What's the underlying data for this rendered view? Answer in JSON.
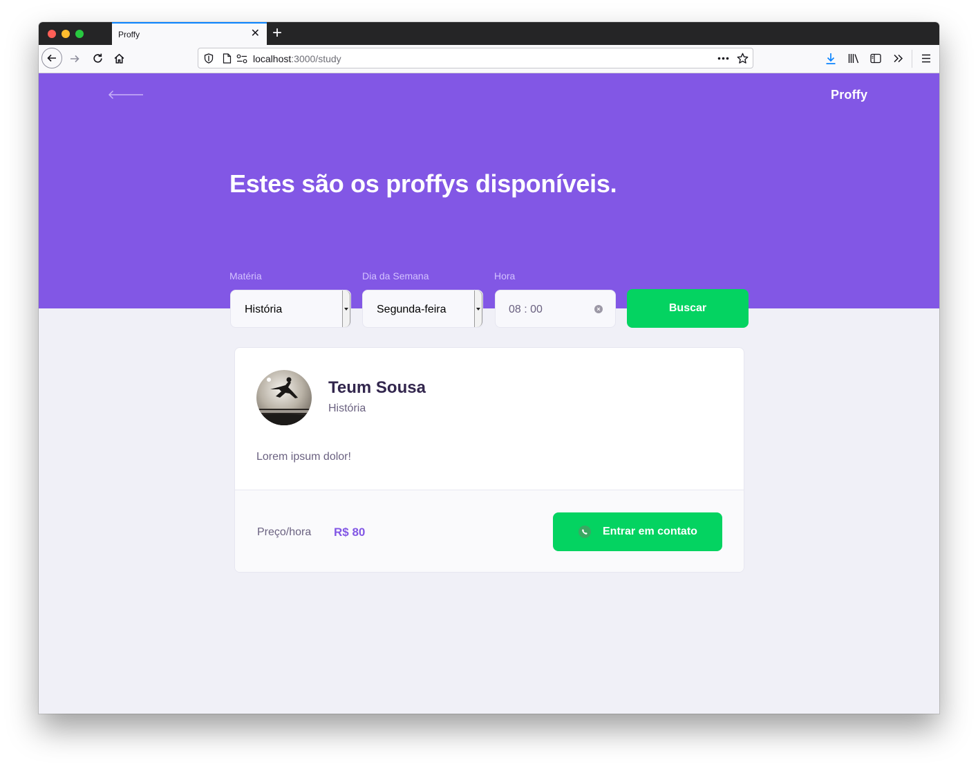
{
  "browser": {
    "tab_title": "Proffy",
    "tab_close": "✕",
    "new_tab": "+",
    "url_host": "localhost",
    "url_path": ":3000/study"
  },
  "header": {
    "brand": "Proffy",
    "title": "Estes são os proffys disponíveis."
  },
  "filters": {
    "subject_label": "Matéria",
    "subject_value": "História",
    "weekday_label": "Dia da Semana",
    "weekday_value": "Segunda-feira",
    "time_label": "Hora",
    "time_value": "08 : 00",
    "submit_label": "Buscar"
  },
  "teacher": {
    "name": "Teum Sousa",
    "subject": "História",
    "bio": "Lorem ipsum dolor!",
    "price_label": "Preço/hora",
    "price_value": "R$ 80",
    "contact_label": "Entrar em contato"
  },
  "colors": {
    "primary": "#8257e5",
    "secondary": "#04d361",
    "background": "#f0f0f7",
    "title_text": "#32264d",
    "body_text": "#6a6180"
  },
  "icons": [
    "back-arrow-icon",
    "forward-arrow-icon",
    "reload-icon",
    "home-icon",
    "shield-icon",
    "page-icon",
    "permissions-icon",
    "more-icon",
    "bookmark-star-icon",
    "download-icon",
    "library-icon",
    "sidebar-icon",
    "overflow-icon",
    "menu-icon",
    "whatsapp-icon"
  ]
}
